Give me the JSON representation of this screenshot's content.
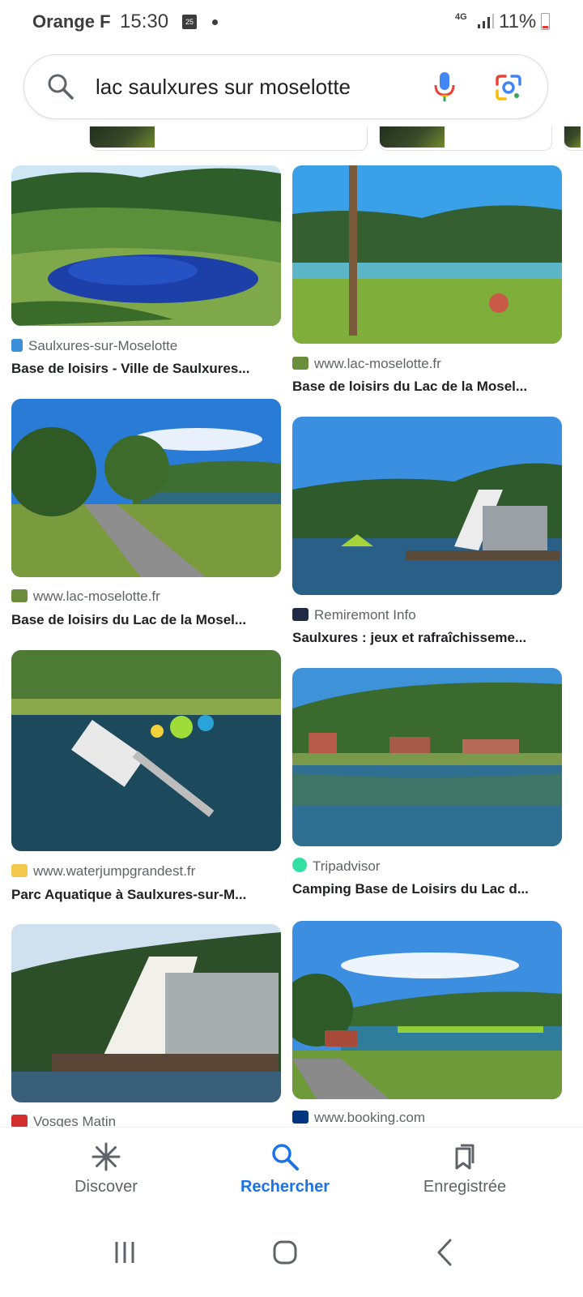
{
  "status_bar": {
    "carrier": "Orange F",
    "time": "15:30",
    "calendar_day": "25",
    "network": "4G",
    "battery": "11%"
  },
  "search": {
    "query": "lac saulxures sur moselotte"
  },
  "results": [
    {
      "source": "Saulxures-sur-Moselotte",
      "title": "Base de loisirs - Ville de Saulxures...",
      "favicon_color": "#3b8fd8"
    },
    {
      "source": "www.lac-moselotte.fr",
      "title": "Base de loisirs du Lac de la Mosel...",
      "favicon_color": "#6b8e3c"
    },
    {
      "source": "www.lac-moselotte.fr",
      "title": "Base de loisirs du Lac de la Mosel...",
      "favicon_color": "#6b8e3c"
    },
    {
      "source": "Remiremont Info",
      "title": "Saulxures : jeux et rafraîchisseme...",
      "favicon_color": "#1f2a44"
    },
    {
      "source": "www.waterjumpgrandest.fr",
      "title": "Parc Aquatique à Saulxures-sur-M...",
      "favicon_color": "#f2c94c"
    },
    {
      "source": "Tripadvisor",
      "title": "Camping Base de Loisirs du Lac d...",
      "favicon_color": "#34e0a1"
    },
    {
      "source": "Vosges Matin",
      "title": "",
      "favicon_color": "#d32f2f"
    },
    {
      "source": "www.booking.com",
      "title": "",
      "favicon_color": "#003580"
    }
  ],
  "bottom_nav": {
    "discover": "Discover",
    "search": "Rechercher",
    "saved": "Enregistrée"
  },
  "colors": {
    "accent": "#1a73e8",
    "text": "#202124",
    "secondary_text": "#5f6368"
  }
}
